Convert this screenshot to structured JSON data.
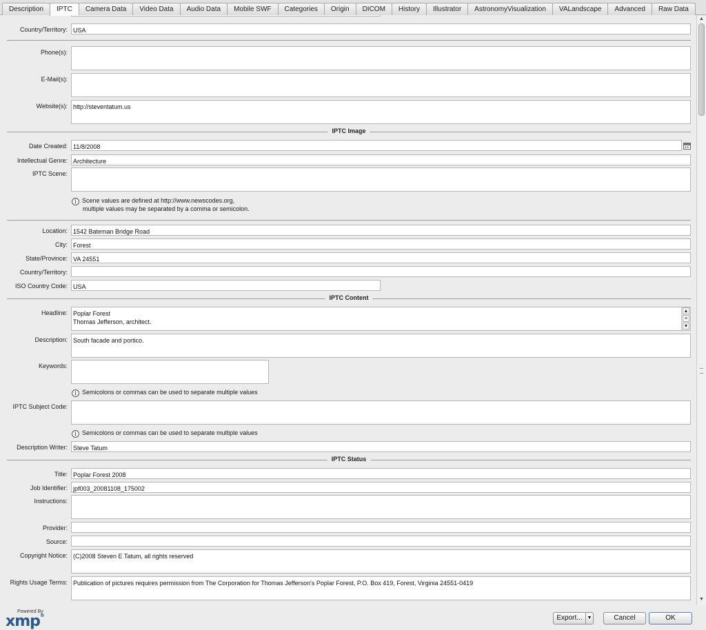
{
  "tabs": [
    "Description",
    "IPTC",
    "Camera Data",
    "Video Data",
    "Audio Data",
    "Mobile SWF",
    "Categories",
    "Origin",
    "DICOM",
    "History",
    "Illustrator",
    "AstronomyVisualization",
    "VALandscape",
    "Advanced",
    "Raw Data"
  ],
  "active_tab": "IPTC",
  "contact": {
    "country_label": "Country/Territory:",
    "country_value": "USA",
    "phone_label": "Phone(s):",
    "phone_value": "",
    "email_label": "E-Mail(s):",
    "email_value": "",
    "website_label": "Website(s):",
    "website_value": "http://steventatum.us"
  },
  "iptc_image": {
    "section_title": "IPTC Image",
    "date_created_label": "Date Created:",
    "date_created_value": "11/8/2008",
    "genre_label": "Intellectual Genre:",
    "genre_value": "Architecture",
    "scene_label": "IPTC Scene:",
    "scene_value": "",
    "scene_hint_1": "Scene values are defined at http://www.newscodes.org,",
    "scene_hint_2": "multiple values may be separated by a comma or semicolon."
  },
  "location": {
    "location_label": "Location:",
    "location_value": "1542 Bateman Bridge Road",
    "city_label": "City:",
    "city_value": "Forest",
    "state_label": "State/Province:",
    "state_value": "VA 24551",
    "country_label": "Country/Territory:",
    "country_value": "",
    "iso_label": "ISO Country Code:",
    "iso_value": "USA"
  },
  "iptc_content": {
    "section_title": "IPTC Content",
    "headline_label": "Headline:",
    "headline_value": "Poplar Forest\nThomas Jefferson, architect.",
    "description_label": "Description:",
    "description_value": "South facade and portico.",
    "keywords_label": "Keywords:",
    "keywords_value": "",
    "keywords_hint": "Semicolons or commas can be used to separate multiple values",
    "subject_label": "IPTC Subject Code:",
    "subject_value": "",
    "subject_hint": "Semicolons or commas can be used to separate multiple values",
    "writer_label": "Description Writer:",
    "writer_value": "Steve Tatum"
  },
  "iptc_status": {
    "section_title": "IPTC Status",
    "title_label": "Title:",
    "title_value": "Poplar Forest 2008",
    "job_label": "Job Identifier:",
    "job_value": "jpf003_20081108_175002",
    "instructions_label": "Instructions:",
    "instructions_value": "",
    "provider_label": "Provider:",
    "provider_value": "",
    "source_label": "Source:",
    "source_value": "",
    "copyright_label": "Copyright Notice:",
    "copyright_value": "(C)2008 Steven E Tatum, all rights reserved",
    "rights_label": "Rights Usage Terms:",
    "rights_value": "Publication of pictures requires permission from The Corporation for Thomas Jefferson's Poplar Forest, P.O. Box 419, Forest, Virginia 24551-0419"
  },
  "footer": {
    "powered_by": "Powered By",
    "logo_text": "xmp",
    "export_label": "Export...",
    "cancel_label": "Cancel",
    "ok_label": "OK"
  },
  "icons": {
    "info": "info-icon",
    "calendar": "calendar-icon",
    "dropdown": "chevron-down-icon"
  }
}
